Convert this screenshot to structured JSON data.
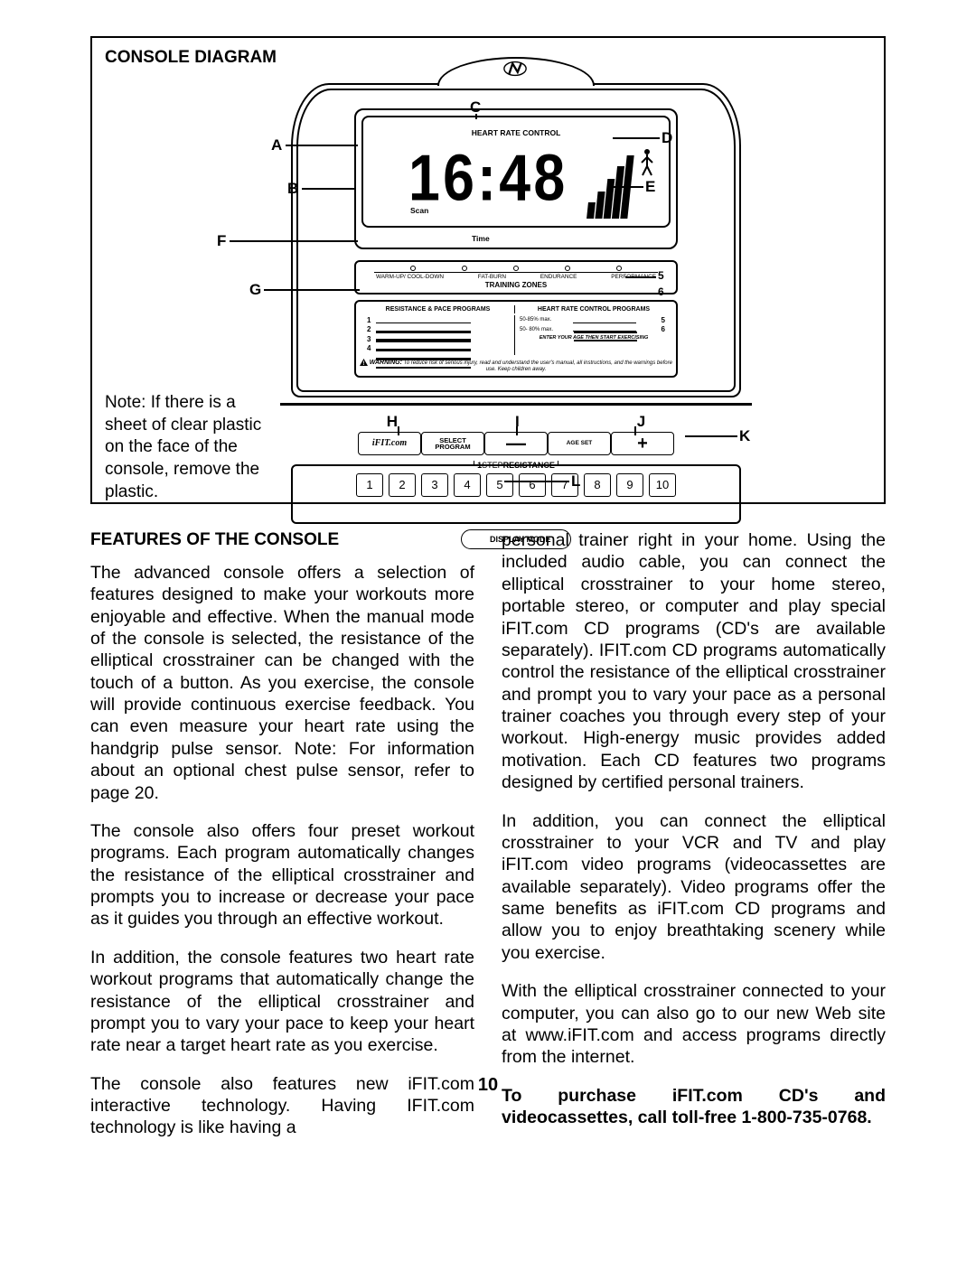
{
  "page_number": "10",
  "diagram": {
    "title": "CONSOLE DIAGRAM",
    "note": "Note: If there is a sheet of clear plastic on the face of the console, remove the plastic.",
    "display": {
      "heart_rate_control": "HEART RATE CONTROL",
      "digits": "16:48",
      "scan": "Scan",
      "time": "Time"
    },
    "training_zones": {
      "labels": [
        "WARM-UP/ COOL-DOWN",
        "FAT-BURN",
        "ENDURANCE",
        "PERFORMANCE"
      ],
      "title": "TRAINING ZONES"
    },
    "programs": {
      "col1_head": "RESISTANCE & PACE PROGRAMS",
      "col2_head": "HEART RATE CONTROL PROGRAMS",
      "left_nums": [
        "1",
        "2",
        "3",
        "4"
      ],
      "right_nums": [
        "5",
        "6"
      ],
      "hr1": "50-85% max.",
      "hr2": "50- 80% max.",
      "enter_age": "ENTER YOUR AGE THEN START EXERCISING",
      "warning_b": "WARNING:",
      "warning_txt": "To reduce risk of serious injury, read and understand the user's manual, all instructions, and the warnings before use.  Keep children away."
    },
    "buttons": {
      "ifit": "iFIT.com",
      "select_program": "SELECT\nPROGRAM",
      "age_set": "AGE SET",
      "minus": "—",
      "plus": "+",
      "resistance_label": "1STEPRESISTANCE",
      "numbers": [
        "1",
        "2",
        "3",
        "4",
        "5",
        "6",
        "7",
        "8",
        "9",
        "10"
      ],
      "display_mode": "DISPLAY MODE"
    },
    "callouts": {
      "A": "A",
      "B": "B",
      "C": "C",
      "D": "D",
      "E": "E",
      "F": "F",
      "G": "G",
      "H": "H",
      "I": "I",
      "J": "J",
      "K": "K",
      "L": "L"
    }
  },
  "features": {
    "heading": "FEATURES OF THE CONSOLE",
    "p1": "The advanced console offers a selection of features designed to make your workouts more enjoyable and effective. When the manual mode of the console is selected, the resistance of the elliptical crosstrainer can be changed with the touch of a button. As you exercise, the console will provide continuous exercise feedback. You can even measure your heart rate using the handgrip pulse sensor. Note: For information about an optional chest pulse sensor, refer to page 20.",
    "p2": "The console also offers four preset workout programs. Each program automatically changes the resistance of the elliptical crosstrainer and prompts you to increase or decrease your pace as it guides you through an effective workout.",
    "p3": "In addition, the console features two heart rate workout programs that automatically change the resistance of the elliptical crosstrainer and prompt you to vary your pace to keep your heart rate near a target heart rate as you exercise.",
    "p4": "The console also features new iFIT.com interactive technology. Having IFIT.com technology is like having a",
    "p5": "personal trainer right in your home. Using the included audio cable, you can connect the elliptical crosstrainer to your home stereo, portable stereo, or computer and play special iFIT.com CD programs (CD's are available separately). IFIT.com CD programs automatically control the resistance of the elliptical crosstrainer and prompt you to vary your pace as a personal trainer coaches you through every step of your workout. High-energy music provides added motivation. Each CD features two programs designed by certified personal trainers.",
    "p6": "In addition, you can connect the elliptical crosstrainer to your VCR and TV and play iFIT.com video programs (videocassettes are available separately). Video programs offer the same benefits as iFIT.com CD programs and allow you to enjoy breathtaking scenery while you exercise.",
    "p7": "With the elliptical crosstrainer connected to your computer, you can also go to our new Web site at www.iFIT.com and access programs directly from the internet.",
    "p8": "To purchase iFIT.com CD's and videocassettes, call toll-free 1-800-735-0768."
  }
}
